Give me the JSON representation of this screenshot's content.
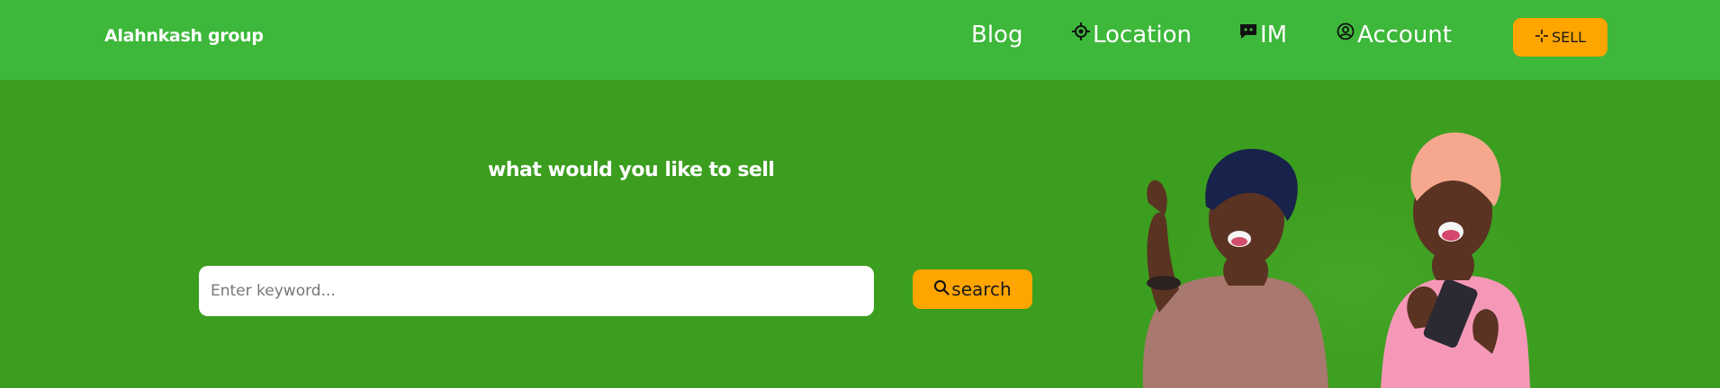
{
  "header": {
    "brand": "Alahnkash group",
    "nav": [
      {
        "label": "Blog",
        "icon": ""
      },
      {
        "label": "Location",
        "icon": "crosshair-icon"
      },
      {
        "label": "IM",
        "icon": "chat-icon"
      },
      {
        "label": "Account",
        "icon": "user-circle-icon"
      }
    ],
    "sell_label": "SELL",
    "sell_icon": "sparkle-icon"
  },
  "hero": {
    "title": "what would you like to sell",
    "search_placeholder": "Enter keyword...",
    "search_value": "",
    "search_button_label": "search",
    "search_icon": "search-icon",
    "image_subject": "two women looking at a phone excitedly"
  },
  "colors": {
    "topbar": "#3db83a",
    "hero": "#3c9e1f",
    "accent": "#ffa500",
    "text": "#ffffff"
  }
}
